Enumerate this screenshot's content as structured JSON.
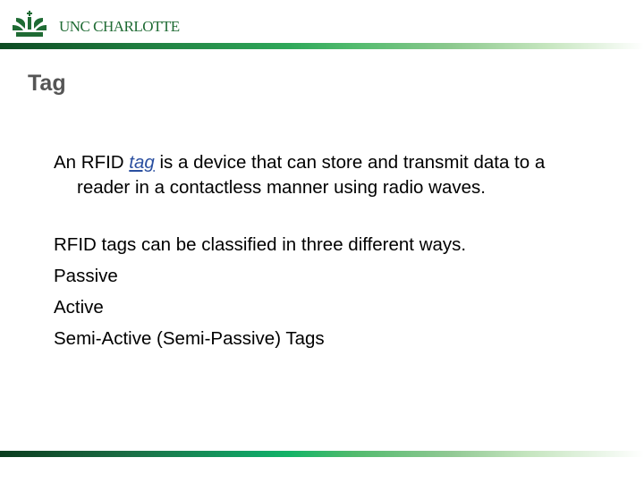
{
  "header": {
    "logo_text": "UNC CHARLOTTE",
    "logo_icon": "unc-charlotte-crown-icon",
    "brand_color": "#1f6b34"
  },
  "slide": {
    "title": "Tag",
    "paragraph": {
      "prefix": "An RFID ",
      "link_text": "tag",
      "suffix_line1": " is a device that can store and transmit data to a",
      "line2": "reader in a contactless manner using radio waves."
    },
    "items": [
      "RFID tags can be classified in three different ways.",
      "Passive",
      "Active",
      "Semi-Active (Semi-Passive) Tags"
    ]
  }
}
